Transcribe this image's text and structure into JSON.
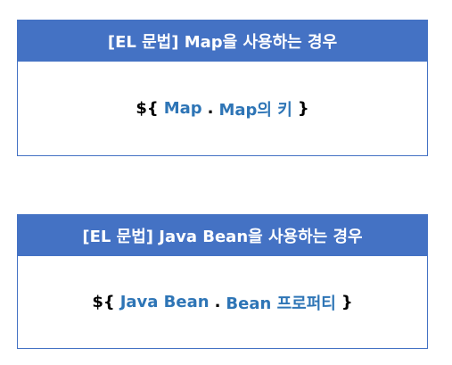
{
  "colors": {
    "header_bg": "#4472c4",
    "border": "#4472c4",
    "keyword": "#2e75b6",
    "text": "#000000"
  },
  "boxes": [
    {
      "title": "[EL 문법] Map을 사용하는 경우",
      "expression": {
        "open": "${",
        "object": "Map",
        "dot": ".",
        "property": "Map의 키",
        "close": "}"
      }
    },
    {
      "title": "[EL 문법] Java Bean을 사용하는 경우",
      "expression": {
        "open": "${",
        "object": "Java Bean",
        "dot": ".",
        "property": "Bean 프로퍼티",
        "close": "}"
      }
    }
  ]
}
